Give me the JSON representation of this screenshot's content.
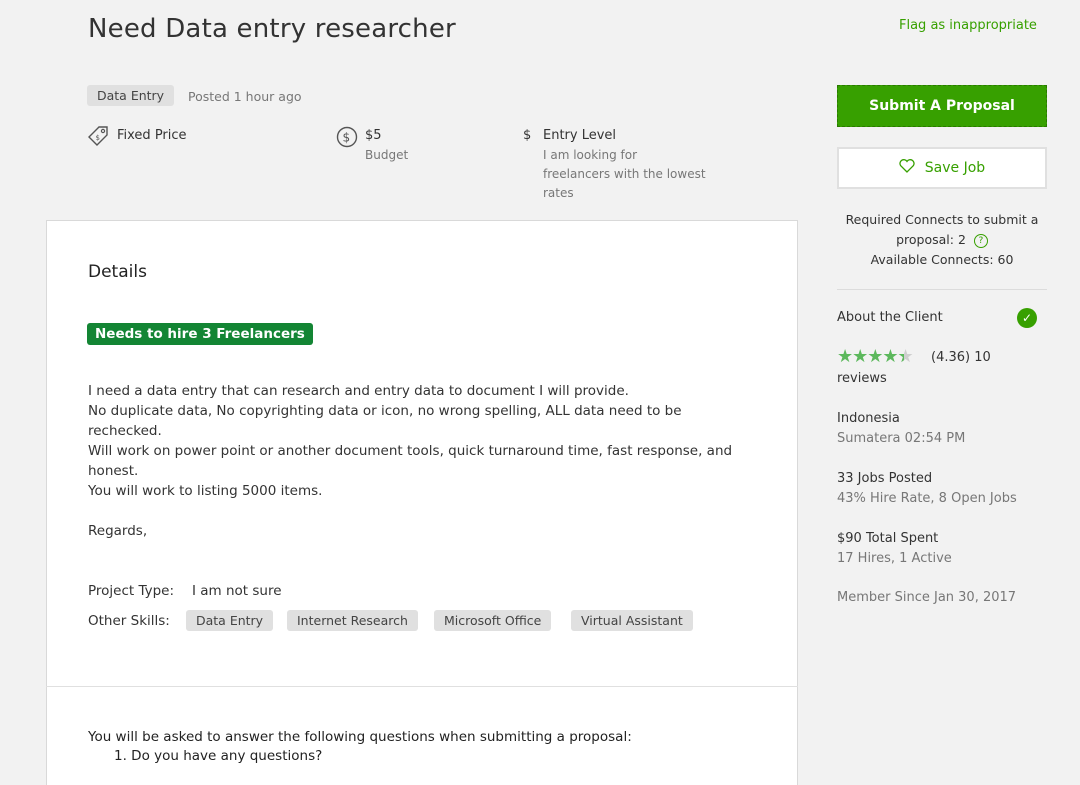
{
  "job": {
    "title": "Need Data entry researcher",
    "flag_label": "Flag as inappropriate",
    "category": "Data Entry",
    "posted": "Posted 1 hour ago"
  },
  "meta": {
    "price_type": "Fixed Price",
    "budget_value": "$5",
    "budget_label": "Budget",
    "currency_symbol": "$",
    "experience_level": "Entry Level",
    "experience_desc_1": "I am looking for",
    "experience_desc_2": "freelancers with the lowest",
    "experience_desc_3": "rates"
  },
  "details": {
    "heading": "Details",
    "hire_badge": "Needs to hire 3 Freelancers",
    "description": [
      "I need a data entry that can research and entry data to document I will provide.",
      "No duplicate data, No copyrighting data or icon, no wrong spelling, ALL data need to be",
      "rechecked.",
      "Will work on power point or another document tools, quick turnaround time, fast response, and",
      "honest.",
      "You will work to listing 5000 items.",
      "Regards,"
    ],
    "project_type_label": "Project Type:",
    "project_type_value": "I am not sure",
    "other_skills_label": "Other Skills:",
    "skills": [
      "Data Entry",
      "Internet Research",
      "Microsoft Office",
      "Virtual Assistant"
    ]
  },
  "questions": {
    "intro": "You will be asked to answer the following questions when submitting a proposal:",
    "items": [
      "1. Do you have any questions?"
    ]
  },
  "sidebar": {
    "submit_label": "Submit A Proposal",
    "save_label": "Save Job",
    "connects_line1": "Required Connects to submit a",
    "connects_line2": "proposal: 2",
    "connects_line3": "Available Connects: 60",
    "about_client": "About the Client",
    "rating_text": "(4.36) 10",
    "reviews_text": "reviews",
    "rating_value": 4.36,
    "location_country": "Indonesia",
    "location_detail": "Sumatera 02:54 PM",
    "jobs_posted": "33 Jobs Posted",
    "hire_rate": "43% Hire Rate, 8 Open Jobs",
    "total_spent": "$90 Total Spent",
    "hires": "17 Hires, 1 Active",
    "member_since": "Member Since Jan 30, 2017"
  },
  "colors": {
    "accent": "#37a000",
    "badge_green": "#138534"
  }
}
